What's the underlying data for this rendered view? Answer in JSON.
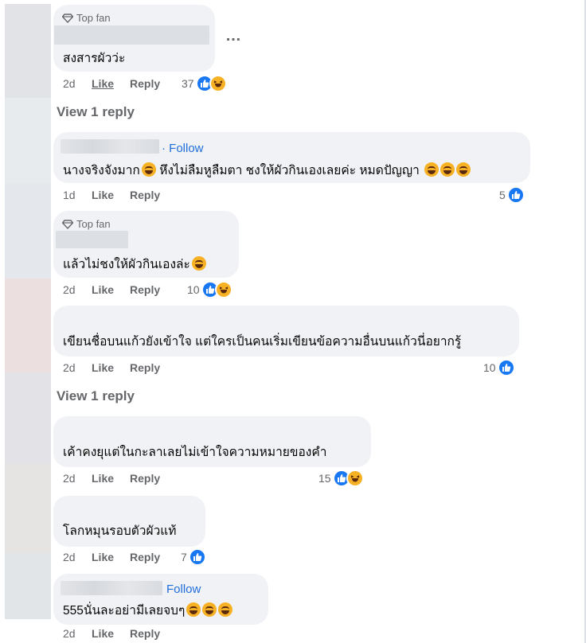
{
  "labels": {
    "top_fan": "Top fan",
    "follow": "Follow",
    "like": "Like",
    "reply": "Reply",
    "view_reply": "View 1 reply",
    "more": "…"
  },
  "comments": [
    {
      "text": "สงสารผัวว่ะ",
      "age": "2d",
      "reactions": "37",
      "badge": "Top fan"
    },
    {
      "text": "นางจริงจังมาก",
      "text2": " หึงไม่ลืมหูลืมตา ชงให้ผัวกินเองเลยค่ะ หมดปัญญา ",
      "age": "1d",
      "reactions": "5",
      "follow": "Follow"
    },
    {
      "text": "แล้วไม่ชงให้ผัวกินเองล่ะ",
      "age": "2d",
      "reactions": "10",
      "badge": "Top fan"
    },
    {
      "text": "เขียนชื่อบนแก้วยังเข้าใจ แต่ใครเป็นคนเริ่มเขียนข้อความอื่นบนแก้วนี่อยากรู้",
      "age": "2d",
      "reactions": "10"
    },
    {
      "text": "เค้าคงยุแต่ในกะลาเลยไม่เข้าใจความหมายของคำ",
      "age": "2d",
      "reactions": "15"
    },
    {
      "text": "โลกหมุนรอบตัวผัวแท้",
      "age": "2d",
      "reactions": "7"
    },
    {
      "text": "555นั่นละอย่ามีเลยจบๆ",
      "age": "2d",
      "follow": "Follow"
    }
  ],
  "colors": {
    "bubble": "#f0f2f5",
    "link": "#216fdb",
    "meta": "#65676b",
    "like_blue": "#1877f2",
    "haha": "#f7b125"
  }
}
